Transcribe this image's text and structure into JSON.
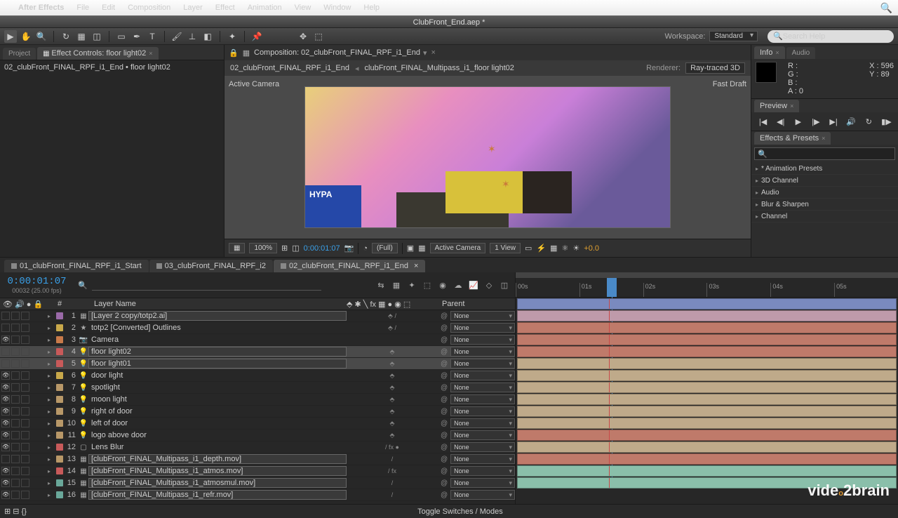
{
  "menubar": {
    "app": "After Effects",
    "items": [
      "File",
      "Edit",
      "Composition",
      "Layer",
      "Effect",
      "Animation",
      "View",
      "Window",
      "Help"
    ]
  },
  "titlebar": "ClubFront_End.aep *",
  "workspace": {
    "label": "Workspace:",
    "value": "Standard"
  },
  "searchHelp": "Search Help",
  "project": {
    "tab": "Project",
    "effTab": "Effect Controls: floor light02",
    "path": "02_clubFront_FINAL_RPF_i1_End • floor light02"
  },
  "compHeader": {
    "label": "Composition:",
    "name": "02_clubFront_FINAL_RPF_i1_End"
  },
  "breadcrumb": {
    "a": "02_clubFront_FINAL_RPF_i1_End",
    "b": "clubFront_FINAL_Multipass_i1_floor light02",
    "rendLbl": "Renderer:",
    "rendVal": "Ray-traced 3D"
  },
  "viewer": {
    "left": "Active Camera",
    "right": "Fast Draft",
    "logo": "HYPA"
  },
  "viewerFoot": {
    "zoom": "100%",
    "tc": "0:00:01:07",
    "res": "(Full)",
    "cam": "Active Camera",
    "views": "1 View",
    "exp": "+0.0"
  },
  "info": {
    "tab": "Info",
    "audioTab": "Audio",
    "R": "R :",
    "G": "G :",
    "B": "B :",
    "A": "A : 0",
    "X": "X : 596",
    "Y": "Y : 89"
  },
  "preview": {
    "tab": "Preview"
  },
  "ep": {
    "tab": "Effects & Presets",
    "items": [
      "* Animation Presets",
      "3D Channel",
      "Audio",
      "Blur & Sharpen",
      "Channel"
    ]
  },
  "compTabs": [
    {
      "name": "01_clubFront_FINAL_RPF_i1_Start",
      "active": false
    },
    {
      "name": "03_clubFront_FINAL_RPF_i2",
      "active": false
    },
    {
      "name": "02_clubFront_FINAL_RPF_i1_End",
      "active": true
    }
  ],
  "timecode": {
    "tc": "0:00:01:07",
    "frames": "00032 (25.00 fps)"
  },
  "cols": {
    "idx": "#",
    "name": "Layer Name",
    "parent": "Parent"
  },
  "parentNone": "None",
  "toggle": "Toggle Switches / Modes",
  "ruler": [
    "00s",
    "01s",
    "02s",
    "03s",
    "04s",
    "05s"
  ],
  "layers": [
    {
      "i": 1,
      "c": "lc-purple",
      "nm": "[Layer 2 copy/totp2.ai]",
      "br": true,
      "ic": "▦",
      "eye": false,
      "sel": false,
      "bar": "b-blue",
      "sw": "⬘ /"
    },
    {
      "i": 2,
      "c": "lc-yellow",
      "nm": "totp2 [Converted] Outlines",
      "br": false,
      "ic": "★",
      "eye": false,
      "sel": false,
      "bar": "b-pink",
      "sw": "⬘ /"
    },
    {
      "i": 3,
      "c": "lc-orange",
      "nm": "Camera",
      "br": false,
      "ic": "📷",
      "eye": true,
      "sel": false,
      "bar": "b-red",
      "sw": ""
    },
    {
      "i": 4,
      "c": "lc-red",
      "nm": "floor light02",
      "br": true,
      "ic": "💡",
      "eye": false,
      "sel": true,
      "bar": "b-red",
      "sw": "⬘"
    },
    {
      "i": 5,
      "c": "lc-red",
      "nm": "floor light01",
      "br": true,
      "ic": "💡",
      "eye": false,
      "sel": true,
      "bar": "b-red",
      "sw": "⬘"
    },
    {
      "i": 6,
      "c": "lc-yellow",
      "nm": "door light",
      "br": false,
      "ic": "💡",
      "eye": true,
      "sel": false,
      "bar": "b-tan",
      "sw": "⬘"
    },
    {
      "i": 7,
      "c": "lc-tan",
      "nm": "spotlight",
      "br": false,
      "ic": "💡",
      "eye": true,
      "sel": false,
      "bar": "b-tan",
      "sw": "⬘"
    },
    {
      "i": 8,
      "c": "lc-tan",
      "nm": "moon light",
      "br": false,
      "ic": "💡",
      "eye": true,
      "sel": false,
      "bar": "b-tan",
      "sw": "⬘"
    },
    {
      "i": 9,
      "c": "lc-tan",
      "nm": "right of door",
      "br": false,
      "ic": "💡",
      "eye": true,
      "sel": false,
      "bar": "b-tan",
      "sw": "⬘"
    },
    {
      "i": 10,
      "c": "lc-tan",
      "nm": "left of door",
      "br": false,
      "ic": "💡",
      "eye": true,
      "sel": false,
      "bar": "b-tan",
      "sw": "⬘"
    },
    {
      "i": 11,
      "c": "lc-tan",
      "nm": "logo above door",
      "br": false,
      "ic": "💡",
      "eye": true,
      "sel": false,
      "bar": "b-tan",
      "sw": "⬘"
    },
    {
      "i": 12,
      "c": "lc-red",
      "nm": "Lens Blur",
      "br": false,
      "ic": "▢",
      "eye": true,
      "sel": false,
      "bar": "b-red",
      "sw": "  / fx   ●"
    },
    {
      "i": 13,
      "c": "lc-tan",
      "nm": "[clubFront_FINAL_Multipass_i1_depth.mov]",
      "br": true,
      "ic": "▦",
      "eye": false,
      "sel": false,
      "bar": "b-tan",
      "sw": "  /"
    },
    {
      "i": 14,
      "c": "lc-red",
      "nm": "[clubFront_FINAL_Multipass_i1_atmos.mov]",
      "br": true,
      "ic": "▦",
      "eye": true,
      "sel": false,
      "bar": "b-red",
      "sw": "  / fx"
    },
    {
      "i": 15,
      "c": "lc-teal",
      "nm": "[clubFront_FINAL_Multipass_i1_atmosmul.mov]",
      "br": true,
      "ic": "▦",
      "eye": true,
      "sel": false,
      "bar": "b-teal",
      "sw": "  /"
    },
    {
      "i": 16,
      "c": "lc-teal",
      "nm": "[clubFront_FINAL_Multipass_i1_refr.mov]",
      "br": true,
      "ic": "▦",
      "eye": true,
      "sel": false,
      "bar": "b-teal",
      "sw": "  /"
    }
  ]
}
